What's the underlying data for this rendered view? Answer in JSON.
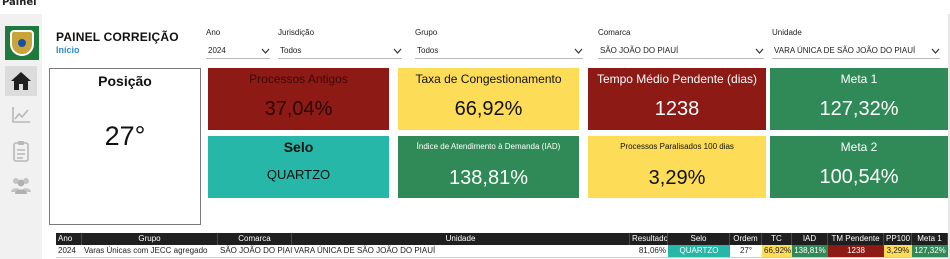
{
  "app": {
    "title": "Painel"
  },
  "sidebar": {
    "icons": [
      "home-icon",
      "chart-icon",
      "checklist-icon",
      "people-icon"
    ]
  },
  "header": {
    "title": "PAINEL CORREIÇÃO",
    "subtitle": "Início"
  },
  "filters": [
    {
      "label": "Ano",
      "value": "2024"
    },
    {
      "label": "Jurisdição",
      "value": "Todos"
    },
    {
      "label": "Grupo",
      "value": "Todos"
    },
    {
      "label": "Comarca",
      "value": "SÃO JOÃO DO PIAUÍ"
    },
    {
      "label": "Unidade",
      "value": "VARA ÚNICA DE SÃO JOÃO DO PIAUÍ"
    }
  ],
  "cards": {
    "posicao": {
      "title": "Posição",
      "value": "27°"
    },
    "processos_antigos": {
      "title": "Processos Antigos",
      "value": "37,04%"
    },
    "taxa_congestionamento": {
      "title": "Taxa de Congestionamento",
      "value": "66,92%"
    },
    "tempo_medio": {
      "title": "Tempo Médio Pendente (dias)",
      "value": "1238"
    },
    "meta1": {
      "title": "Meta 1",
      "value": "127,32%"
    },
    "selo": {
      "title": "Selo",
      "value": "QUARTZO"
    },
    "iad": {
      "title": "Índice de Atendimento à Demanda (IAD)",
      "value": "138,81%"
    },
    "paralisados": {
      "title": "Processos Paralisados 100 dias",
      "value": "3,29%"
    },
    "meta2": {
      "title": "Meta 2",
      "value": "100,54%"
    }
  },
  "table": {
    "headers": [
      "Ano",
      "Grupo",
      "Comarca",
      "Unidade",
      "Resultado",
      "Selo",
      "Ordem",
      "TC",
      "IAD",
      "TM Pendente",
      "PP100",
      "Meta 1"
    ],
    "row": [
      "2024",
      "Varas Únicas com JECC agregado",
      "SÃO JOÃO DO PIAUÍ",
      "VARA ÚNICA DE SÃO JOÃO DO PIAUÍ",
      "81,06%",
      "QUARTZO",
      "27°",
      "66,92%",
      "138,81%",
      "1238",
      "3,29%",
      "127,32%"
    ]
  },
  "colors": {
    "red": "#8e1a16",
    "yellow": "#fddc58",
    "green": "#2f8a57",
    "teal": "#27b7a9",
    "accent": "#2e8bd6"
  }
}
